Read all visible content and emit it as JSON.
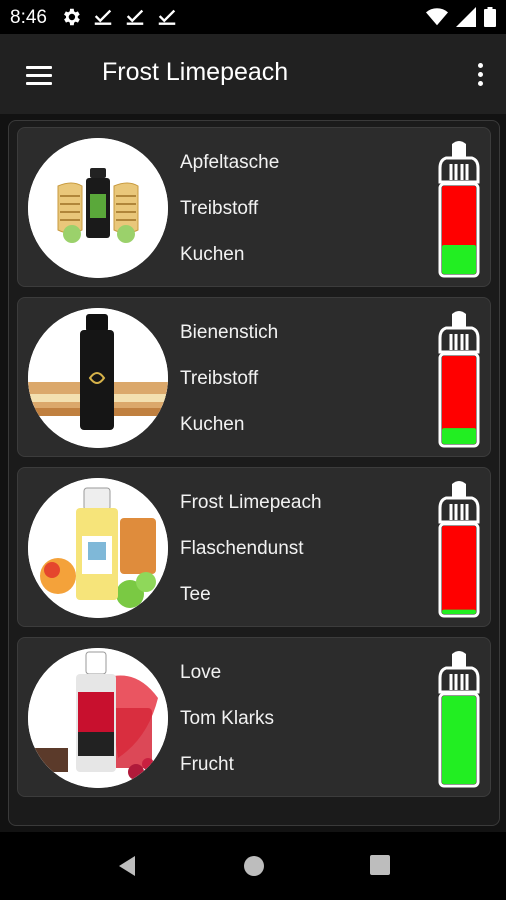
{
  "status_bar": {
    "time": "8:46",
    "icons_left": [
      "gear-icon",
      "download-done-icon",
      "download-done-icon",
      "download-done-icon"
    ],
    "icons_right": [
      "wifi-icon",
      "signal-icon",
      "battery-icon"
    ]
  },
  "app_bar": {
    "title": "Frost Limepeach",
    "menu_icon": "hamburger-menu-icon",
    "overflow_icon": "more-vert-icon"
  },
  "colors": {
    "fill_green": "#22ee22",
    "empty_red": "#ff0000",
    "card_bg": "#2c2c2c",
    "appbar_bg": "#212121"
  },
  "items": [
    {
      "name": "Apfeltasche",
      "brand": "Treibstoff",
      "category": "Kuchen",
      "fill_level": 0.33,
      "image_icon": "apfeltasche-product-image"
    },
    {
      "name": "Bienenstich",
      "brand": "Treibstoff",
      "category": "Kuchen",
      "fill_level": 0.18,
      "image_icon": "bienenstich-product-image"
    },
    {
      "name": "Frost Limepeach",
      "brand": "Flaschendunst",
      "category": "Tee",
      "fill_level": 0.05,
      "image_icon": "frost-limepeach-product-image"
    },
    {
      "name": "Love",
      "brand": "Tom Klarks",
      "category": "Frucht",
      "fill_level": 1.0,
      "image_icon": "love-product-image"
    }
  ],
  "nav_bar": {
    "icons": [
      "back-icon",
      "home-icon",
      "recents-icon"
    ]
  }
}
